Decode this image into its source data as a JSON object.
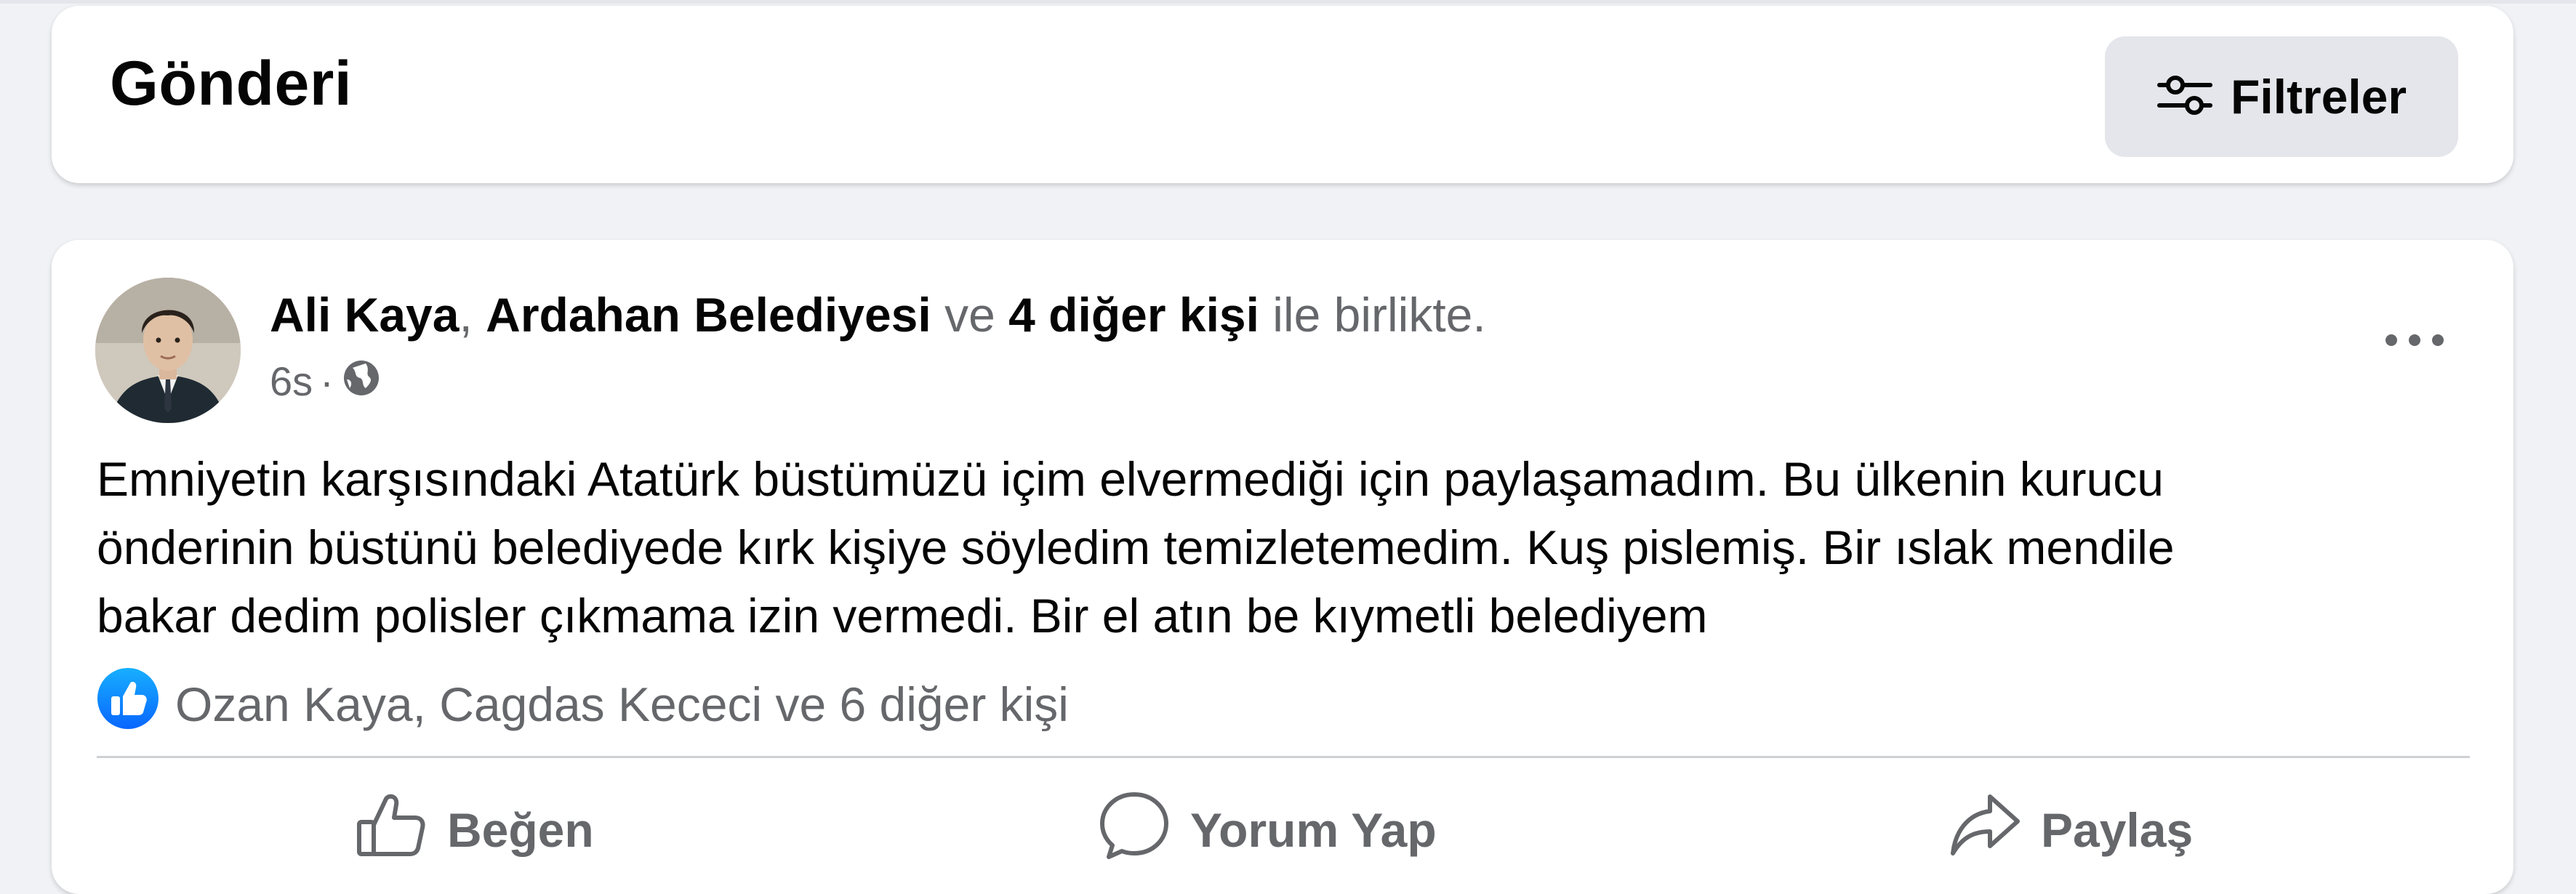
{
  "header": {
    "title": "Gönderi",
    "filter_label": "Filtreler",
    "filter_icon": "sliders-icon"
  },
  "post": {
    "author": "Ali Kaya",
    "separator": ",",
    "tagged_1": "Ardahan Belediyesi",
    "connector": "ve",
    "others": "4 diğer kişi",
    "suffix": "ile birlikte.",
    "time": "6s",
    "dot": "·",
    "privacy_icon": "globe-icon",
    "more_icon": "more-horizontal-icon",
    "text_lines": [
      "Emniyetin karşısındaki Atatürk büstümüzü içim elvermediği için paylaşamadım. Bu ülkenin kurucu",
      "önderinin büstünü belediyede kırk kişiye söyledim temizletemedim. Kuş pislemiş. Bir ıslak mendile",
      "bakar dedim polisler çıkmama izin vermedi. Bir el atın be kıymetli belediyem"
    ],
    "reactions_text": "Ozan Kaya, Cagdas Kececi ve 6 diğer kişi",
    "reaction_icon": "like-reaction-icon"
  },
  "actions": {
    "like": "Beğen",
    "comment": "Yorum Yap",
    "share": "Paylaş"
  },
  "colors": {
    "background": "#f0f2f5",
    "card": "#ffffff",
    "secondary_text": "#65676b",
    "like_blue": "#0866ff",
    "button_gray": "#e4e6eb"
  }
}
